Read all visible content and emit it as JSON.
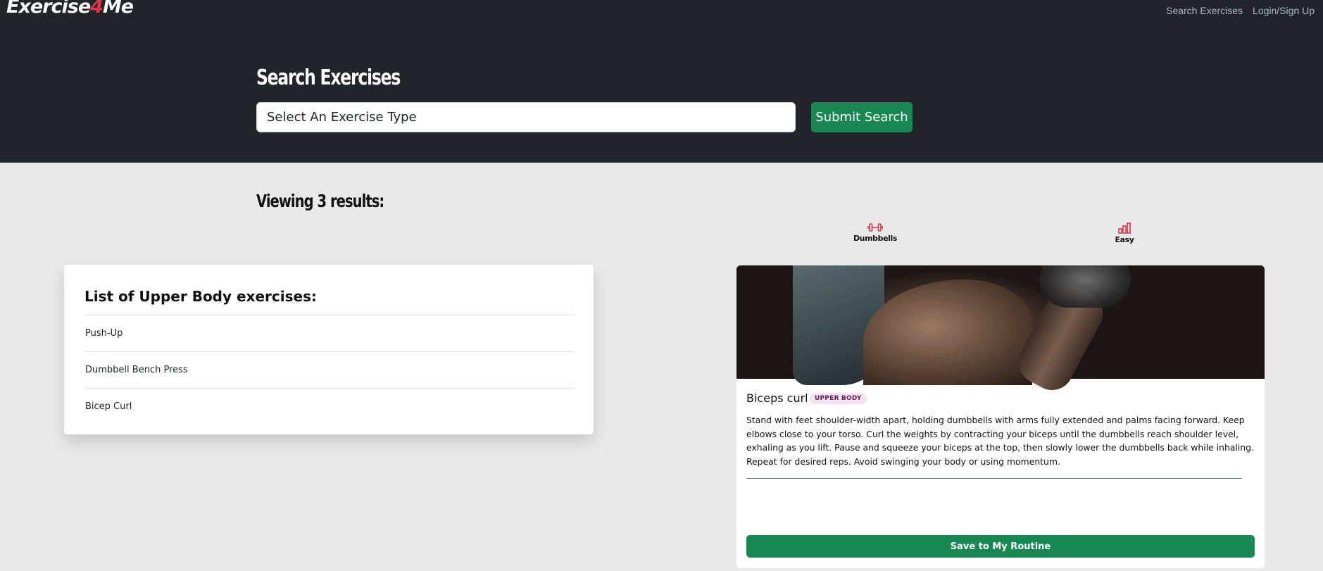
{
  "brand": {
    "name_part1": "Exercise",
    "name_accent": "4",
    "name_part2": "Me"
  },
  "nav": {
    "items": [
      {
        "label": "Search Exercises"
      },
      {
        "label": "Login/Sign Up"
      }
    ]
  },
  "search": {
    "title": "Search Exercises",
    "input_value": "Select An Exercise Type",
    "submit_label": "Submit Search"
  },
  "results": {
    "heading": "Viewing 3 results:"
  },
  "list_card": {
    "title": "List of Upper Body exercises:",
    "items": [
      "Push-Up",
      "Dumbbell Bench Press",
      "Bicep Curl"
    ]
  },
  "exercise_card": {
    "name": "Biceps curl",
    "badge": "UPPER BODY",
    "description": "Stand with feet shoulder-width apart, holding dumbbells with arms fully extended and palms facing forward. Keep elbows close to your torso. Curl the weights by contracting your biceps until the dumbbells reach shoulder level, exhaling as you lift. Pause and squeeze your biceps at the top, then slowly lower the dumbbells back while inhaling. Repeat for desired reps. Avoid swinging your body or using momentum.",
    "equipment": {
      "icon": "dumbbell-icon",
      "label": "Dumbbells"
    },
    "difficulty": {
      "icon": "bar-chart-icon",
      "label": "Easy"
    },
    "save_label": "Save to My Routine"
  },
  "colors": {
    "header_bg": "#212529",
    "page_bg": "#e8e9e8",
    "primary_green": "#198754",
    "accent_red": "#dc3545",
    "badge_bg": "#f2e3f0",
    "badge_text": "#6f1a5e"
  }
}
